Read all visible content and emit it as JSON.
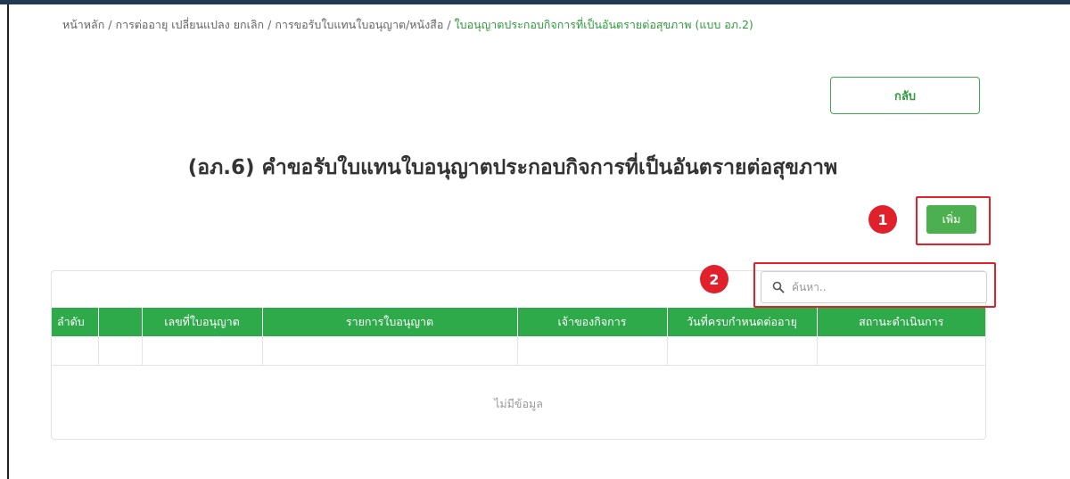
{
  "breadcrumb": {
    "items": [
      "หน้าหลัก",
      "การต่ออายุ เปลี่ยนแปลง ยกเลิก",
      "การขอรับใบแทนใบอนุญาต/หนังสือ"
    ],
    "active": "ใบอนุญาตประกอบกิจการที่เป็นอันตรายต่อสุขภาพ (แบบ อภ.2)"
  },
  "back_button": "กลับ",
  "page_title": "(อภ.6) คำขอรับใบแทนใบอนุญาตประกอบกิจการที่เป็นอันตรายต่อสุขภาพ",
  "add_button": "เพิ่ม",
  "annotations": {
    "one": "1",
    "two": "2"
  },
  "search": {
    "placeholder": "ค้นหา..",
    "value": ""
  },
  "table": {
    "columns": [
      "ลำดับ",
      "",
      "เลขที่ใบอนุญาต",
      "รายการใบอนุญาต",
      "เจ้าของกิจการ",
      "วันที่ครบกำหนดต่ออายุ",
      "สถานะดำเนินการ"
    ],
    "empty_text": "ไม่มีข้อมูล"
  },
  "colors": {
    "accent": "#2eaa4a",
    "annotation": "#e0212c",
    "breadcrumb_active": "#2e9b3c"
  }
}
